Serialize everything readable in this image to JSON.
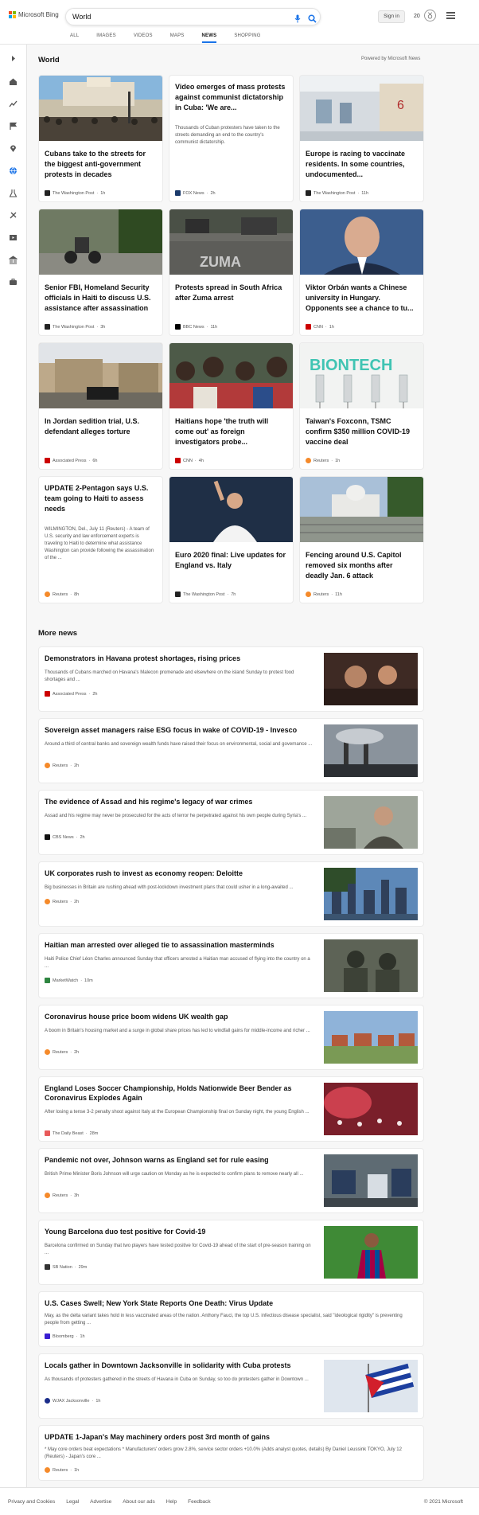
{
  "header": {
    "logo_text": "Microsoft Bing",
    "search_value": "World",
    "signin_label": "Sign in",
    "reward_points": "20",
    "nav": [
      {
        "label": "ALL"
      },
      {
        "label": "IMAGES"
      },
      {
        "label": "VIDEOS"
      },
      {
        "label": "MAPS"
      },
      {
        "label": "NEWS"
      },
      {
        "label": "SHOPPING"
      }
    ],
    "active_nav": "NEWS",
    "colors": {
      "accent": "#1a73e8",
      "ms_red": "#f25022",
      "ms_green": "#7fba00",
      "ms_blue": "#00a4ef",
      "ms_yellow": "#ffb900"
    }
  },
  "rail": {
    "icons": [
      "expand-icon",
      "home-icon",
      "trending-icon",
      "flag-icon",
      "location-icon",
      "world-icon",
      "science-icon",
      "sports-icon",
      "entertainment-icon",
      "politics-icon",
      "business-icon"
    ],
    "active_icon": "world-icon"
  },
  "main": {
    "section_title": "World",
    "powered_by": "Powered by Microsoft News",
    "cards": [
      {
        "title": "Cubans take to the streets for the biggest anti-government protests in decades",
        "source": "The Washington Post",
        "age": "1h",
        "image": "street-crowd"
      },
      {
        "title": "Video emerges of mass protests against communist dictatorship in Cuba: 'We are...",
        "desc": "Thousands of Cuban protesters have taken to the streets demanding an end to the country's communist dictatorship.",
        "source": "FOX News",
        "age": "2h",
        "image": null
      },
      {
        "title": "Europe is racing to vaccinate residents. In some countries, undocumented...",
        "source": "The Washington Post",
        "age": "11h",
        "image": "vaccine-room"
      },
      {
        "title": "Senior FBI, Homeland Security officials in Haiti to discuss U.S. assistance after assassination",
        "source": "The Washington Post",
        "age": "3h",
        "image": "motorcycle"
      },
      {
        "title": "Protests spread in South Africa after Zuma arrest",
        "source": "BBC News",
        "age": "11h",
        "image": "zuma-road"
      },
      {
        "title": "Viktor Orbán wants a Chinese university in Hungary. Opponents see a chance to tu...",
        "source": "CNN",
        "age": "1h",
        "image": "portrait"
      },
      {
        "title": "In Jordan sedition trial, U.S. defendant alleges torture",
        "source": "Associated Press",
        "age": "6h",
        "image": "courthouse"
      },
      {
        "title": "Haitians hope 'the truth will come out' as foreign investigators probe...",
        "source": "CNN",
        "age": "4h",
        "image": "haiti-crowd"
      },
      {
        "title": "Taiwan's Foxconn, TSMC confirm $350 million COVID-19 vaccine deal",
        "source": "Reuters",
        "age": "1h",
        "image": "biontech"
      },
      {
        "title": "UPDATE 2-Pentagon says U.S. team going to Haiti to assess needs",
        "desc": "WILMINGTON, Del., July 11 (Reuters) - A team of U.S. security and law enforcement experts is traveling to Haiti to determine what assistance Washington can provide following the assassination of the ...",
        "source": "Reuters",
        "age": "8h",
        "image": null
      },
      {
        "title": "Euro 2020 final: Live updates for England vs. Italy",
        "source": "The Washington Post",
        "age": "7h",
        "image": "footballer"
      },
      {
        "title": "Fencing around U.S. Capitol removed six months after deadly Jan. 6 attack",
        "source": "Reuters",
        "age": "11h",
        "image": "capitol"
      }
    ],
    "more_title": "More news",
    "more": [
      {
        "title": "Demonstrators in Havana protest shortages, rising prices",
        "desc": "Thousands of Cubans marched on Havana's Malecon promenade and elsewhere on the island Sunday to protest food shortages and ...",
        "source": "Associated Press",
        "age": "2h",
        "image": "protest"
      },
      {
        "title": "Sovereign asset managers raise ESG focus in wake of COVID-19 - Invesco",
        "desc": "Around a third of central banks and sovereign wealth funds have raised their focus on environmental, social and governance ...",
        "source": "Reuters",
        "age": "2h",
        "image": "smokestacks"
      },
      {
        "title": "The evidence of Assad and his regime's legacy of war crimes",
        "desc": "Assad and his regime may never be prosecuted for the acts of terror he perpetrated against his own people during Syria's ...",
        "source": "CBS News",
        "age": "2h",
        "image": "man"
      },
      {
        "title": "UK corporates rush to invest as economy reopen: Deloitte",
        "desc": "Big businesses in Britain are rushing ahead with post-lockdown investment plans that could usher in a long-awaited ...",
        "source": "Reuters",
        "age": "2h",
        "image": "skyline"
      },
      {
        "title": "Haitian man arrested over alleged tie to assassination masterminds",
        "desc": "Haiti Police Chief Léon Charles announced Sunday that officers arrested a Haitian man accused of flying into the country on a ...",
        "source": "MarketWatch",
        "age": "10m",
        "image": "soldiers"
      },
      {
        "title": "Coronavirus house price boom widens UK wealth gap",
        "desc": "A boom in Britain's housing market and a surge in global share prices has led to windfall gains for middle-income and richer ...",
        "source": "Reuters",
        "age": "2h",
        "image": "houses"
      },
      {
        "title": "England Loses Soccer Championship, Holds Nationwide Beer Bender as Coronavirus Explodes Again",
        "desc": "After losing a tense 3-2 penalty shoot against Italy at the European Championship final on Sunday night, the young English ...",
        "source": "The Daily Beast",
        "age": "28m",
        "image": "fans"
      },
      {
        "title": "Pandemic not over, Johnson warns as England set for rule easing",
        "desc": "British Prime Minister Boris Johnson will urge caution on Monday as he is expected to confirm plans to remove nearly all ...",
        "source": "Reuters",
        "age": "3h",
        "image": "vaccination"
      },
      {
        "title": "Young Barcelona duo test positive for Covid-19",
        "desc": "Barcelona confirmed on Sunday that two players have tested positive for Covid-19 ahead of the start of pre-season training on ...",
        "source": "SB Nation",
        "age": "29m",
        "image": "barca"
      },
      {
        "title": "U.S. Cases Swell; New York State Reports One Death: Virus Update",
        "desc": "May, as the delta variant takes hold in less vaccinated areas of the nation. Anthony Fauci, the top U.S. infectious disease specialist, said \"ideological rigidity\" is preventing people from getting ...",
        "source": "Bloomberg",
        "age": "1h",
        "image": null
      },
      {
        "title": "Locals gather in Downtown Jacksonville in solidarity with Cuba protests",
        "desc": "As thousands of protesters gathered in the streets of Havana in Cuba on Sunday, so too do protesters gather in Downtown ...",
        "source": "WJAX Jacksonville",
        "age": "1h",
        "image": "cuba-flag"
      },
      {
        "title": "UPDATE 1-Japan's May machinery orders post 3rd month of gains",
        "desc": "* May core orders beat expectations * Manufacturers' orders grow 2.8%, service sector orders +10.0% (Adds analyst quotes, details) By Daniel Leussink TOKYO, July 12 (Reuters) - Japan's core ...",
        "source": "Reuters",
        "age": "1h",
        "image": null
      }
    ]
  },
  "footer": {
    "links": [
      "Privacy and Cookies",
      "Legal",
      "Advertise",
      "About our ads",
      "Help",
      "Feedback"
    ],
    "copyright": "© 2021 Microsoft"
  }
}
